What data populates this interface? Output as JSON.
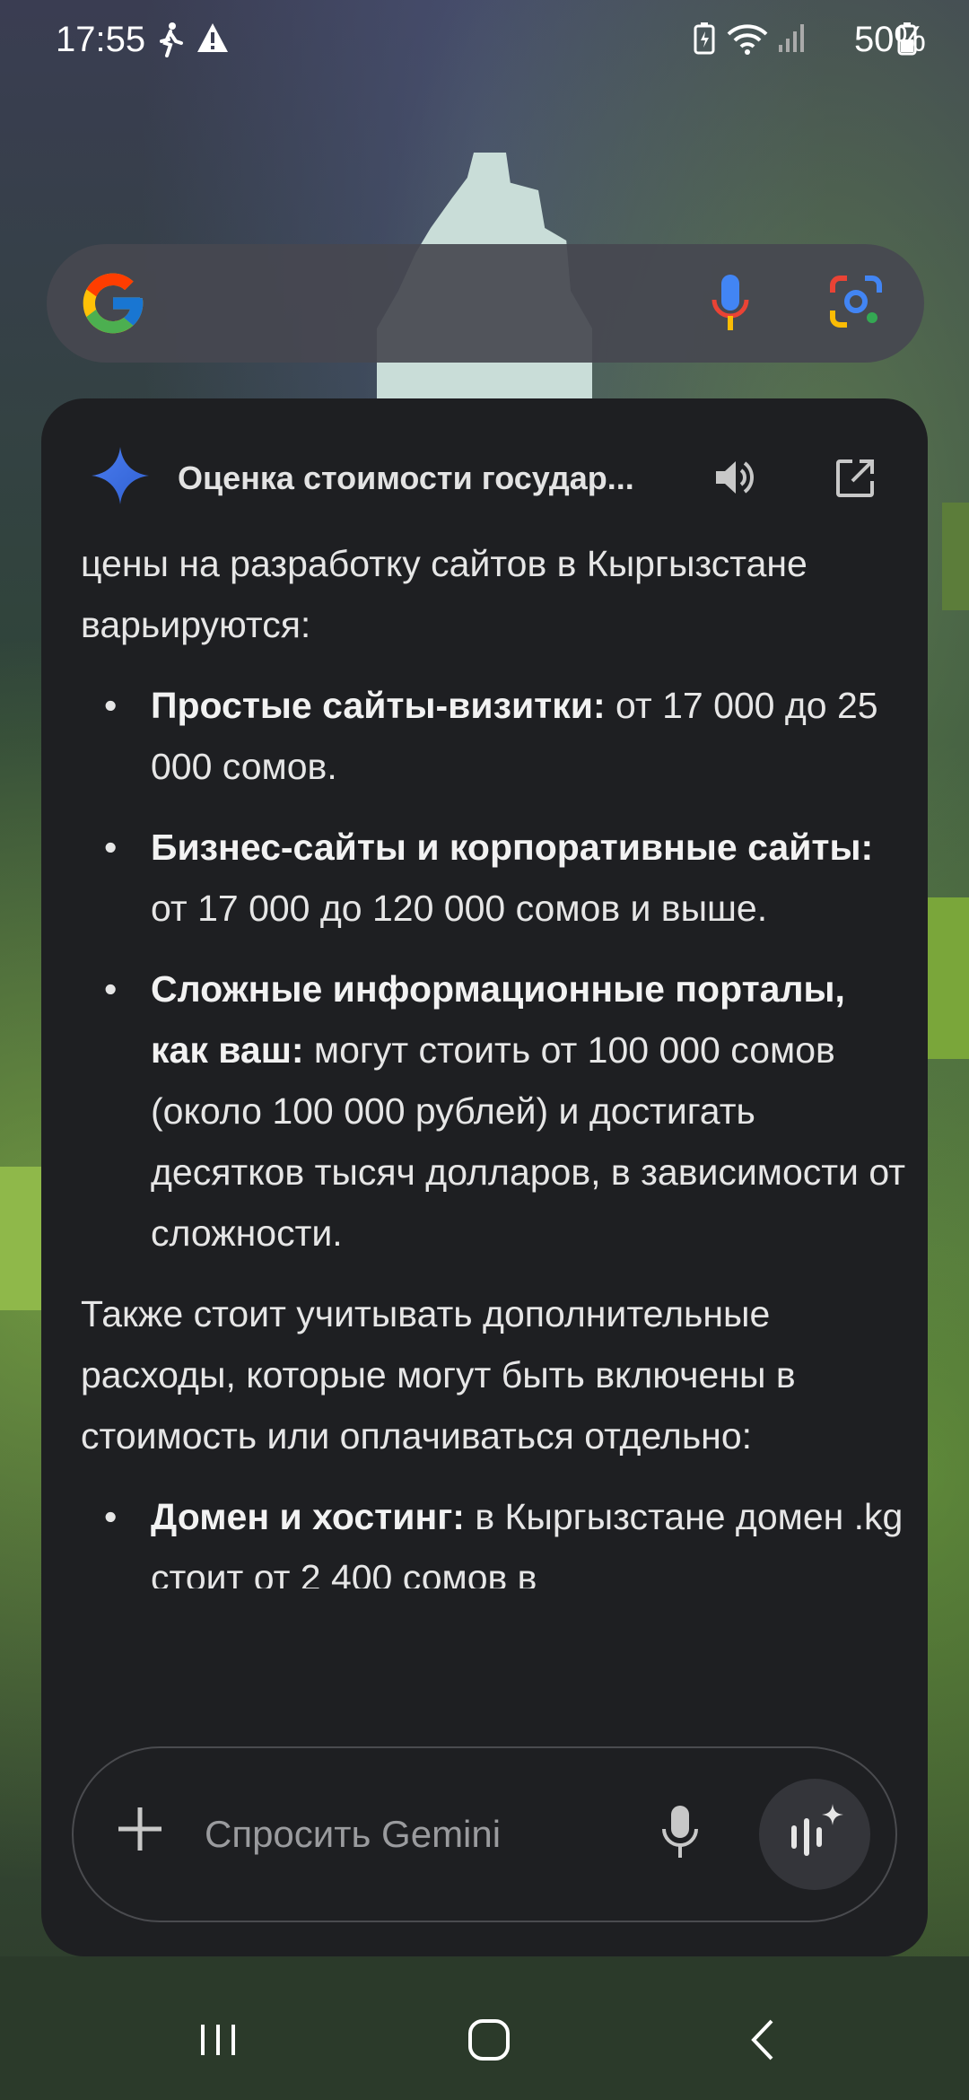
{
  "status_bar": {
    "time": "17:55",
    "battery_percent": "50%"
  },
  "search_bar": {
    "logo": "google-g-icon"
  },
  "gemini_card": {
    "title": "Оценка стоимости государ...",
    "content": {
      "intro_tail": "цены на разработку сайтов в Кыргызстане варьируются:",
      "list1": [
        {
          "bold": "Простые сайты-визитки:",
          "text": " от 17 000 до 25 000 сомов."
        },
        {
          "bold": "Бизнес-сайты и корпоративные сайты:",
          "text": " от 17 000 до 120 000 сомов и выше."
        },
        {
          "bold": "Сложные информационные порталы, как ваш:",
          "text": " могут стоить от 100 000 сомов (около 100 000 рублей) и достигать десятков тысяч долларов, в зависимости от сложности."
        }
      ],
      "paragraph2": "Также стоит учитывать дополнительные расходы, которые могут быть включены в стоимость или оплачиваться отдельно:",
      "list2": [
        {
          "bold": "Домен и хостинг:",
          "text": " в Кыргызстане домен .kg стоит от 2 400 сомов в"
        }
      ]
    },
    "input": {
      "placeholder": "Спросить Gemini"
    }
  },
  "colors": {
    "card_bg": "#1e1f22",
    "text": "#e6e6e6",
    "gemini_blue": "#4a7cf0"
  }
}
